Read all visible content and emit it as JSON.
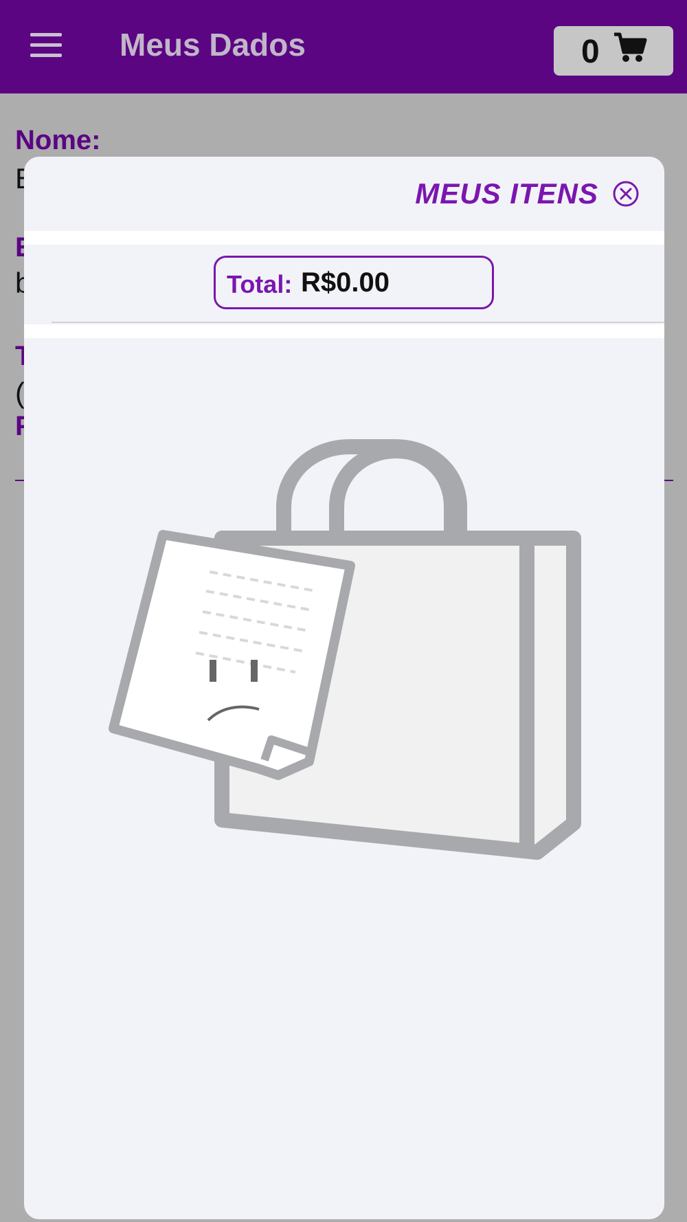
{
  "header": {
    "title": "Meus Dados",
    "cart_count": "0"
  },
  "background_page": {
    "name_label": "Nome:",
    "name_value_fragment": "E",
    "email_label_fragment": "E",
    "email_value_fragment": "b",
    "phone_label_fragment": "T",
    "phone_value_fragment": "(",
    "extra_label_fragment": "F"
  },
  "cart_modal": {
    "title": "MEUS ITENS",
    "total_label": "Total:",
    "total_value": "R$0.00",
    "illustration": "empty-shopping-bag-sad-receipt"
  },
  "colors": {
    "header_bg": "#5b0583",
    "accent": "#7b16ae",
    "modal_bg": "#f2f3f8",
    "overlay": "#adadad",
    "illustration_gray": "#a8a9ad"
  }
}
